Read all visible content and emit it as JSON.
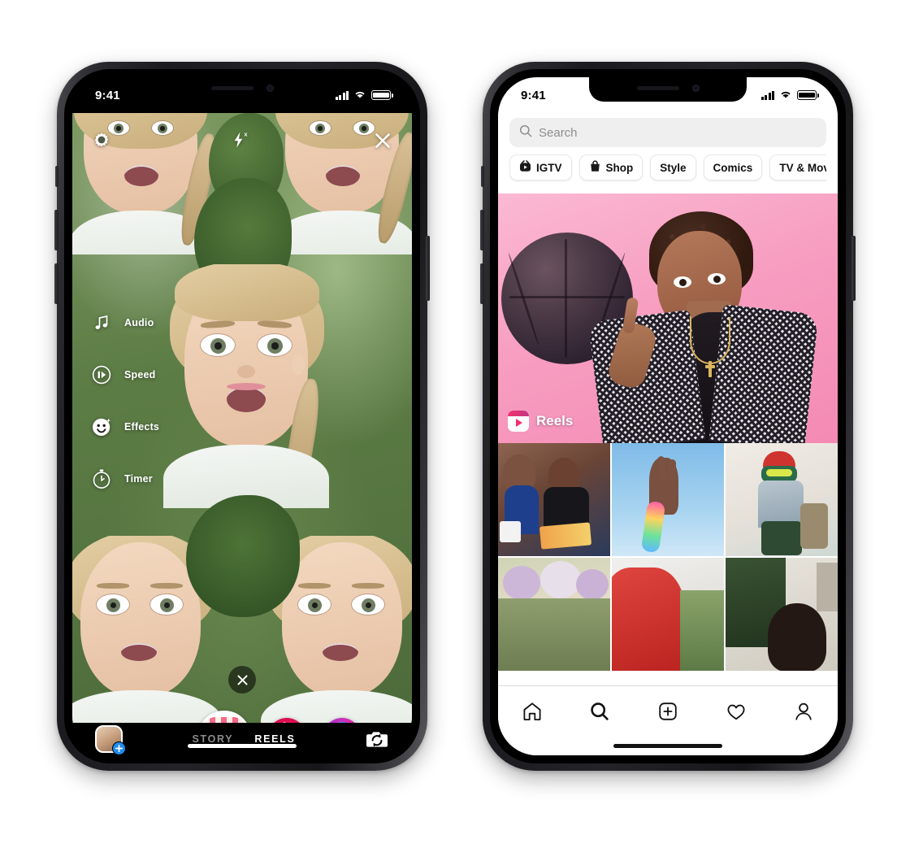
{
  "meta": {
    "scene": "Instagram Reels announcement — two iPhone mockups side by side"
  },
  "left_phone": {
    "status_bar": {
      "time": "9:41",
      "signal_icon": "cellular-bars-icon",
      "wifi_icon": "wifi-icon",
      "battery_icon": "battery-full-icon"
    },
    "camera": {
      "top_controls": [
        {
          "name": "settings",
          "icon": "gear-icon",
          "label": "Settings"
        },
        {
          "name": "flash",
          "icon": "flash-off-icon",
          "label": "Flash off"
        },
        {
          "name": "close",
          "icon": "close-icon",
          "label": "Close"
        }
      ],
      "tools": [
        {
          "label": "Audio",
          "icon": "music-note-icon",
          "active": false
        },
        {
          "label": "Speed",
          "icon": "speed-gauge-icon",
          "active": false
        },
        {
          "label": "Effects",
          "icon": "smiley-face-icon",
          "active": true
        },
        {
          "label": "Timer",
          "icon": "stopwatch-icon",
          "active": false
        }
      ],
      "effect_close_icon": "close-small-icon",
      "effects_carousel": [
        {
          "name": "reels-effect",
          "selected": true,
          "color": "#f4306d"
        },
        {
          "name": "hearts-effect",
          "selected": false,
          "color": "#e01050"
        },
        {
          "name": "blue-orb-effect",
          "selected": false,
          "color": "#2b7fe0"
        }
      ],
      "bottom_bar": {
        "gallery_icon": "gallery-thumbnail-icon",
        "gallery_add_icon": "plus-badge-icon",
        "modes": [
          {
            "label": "STORY",
            "selected": false
          },
          {
            "label": "REELS",
            "selected": true
          }
        ],
        "flip_camera_icon": "flip-camera-icon"
      }
    }
  },
  "right_phone": {
    "status_bar": {
      "time": "9:41",
      "signal_icon": "cellular-bars-icon",
      "wifi_icon": "wifi-icon",
      "battery_icon": "battery-full-icon"
    },
    "explore": {
      "search": {
        "placeholder": "Search",
        "icon": "search-icon"
      },
      "chips": [
        {
          "label": "IGTV",
          "icon": "igtv-icon"
        },
        {
          "label": "Shop",
          "icon": "shopping-bag-icon"
        },
        {
          "label": "Style",
          "icon": ""
        },
        {
          "label": "Comics",
          "icon": ""
        },
        {
          "label": "TV & Movies",
          "icon": ""
        }
      ],
      "hero": {
        "badge_label": "Reels",
        "badge_icon": "reels-icon",
        "background_color": "#f79ec1"
      },
      "grid_items": [
        {
          "name": "grid-thumb-1"
        },
        {
          "name": "grid-thumb-2"
        },
        {
          "name": "grid-thumb-3"
        },
        {
          "name": "grid-thumb-4"
        },
        {
          "name": "grid-thumb-5"
        },
        {
          "name": "grid-thumb-6"
        }
      ],
      "tabbar": [
        {
          "name": "home",
          "icon": "home-icon",
          "selected": false
        },
        {
          "name": "search",
          "icon": "search-icon",
          "selected": true
        },
        {
          "name": "create",
          "icon": "plus-box-icon",
          "selected": false
        },
        {
          "name": "activity",
          "icon": "heart-icon",
          "selected": false
        },
        {
          "name": "profile",
          "icon": "person-icon",
          "selected": false
        }
      ]
    }
  }
}
